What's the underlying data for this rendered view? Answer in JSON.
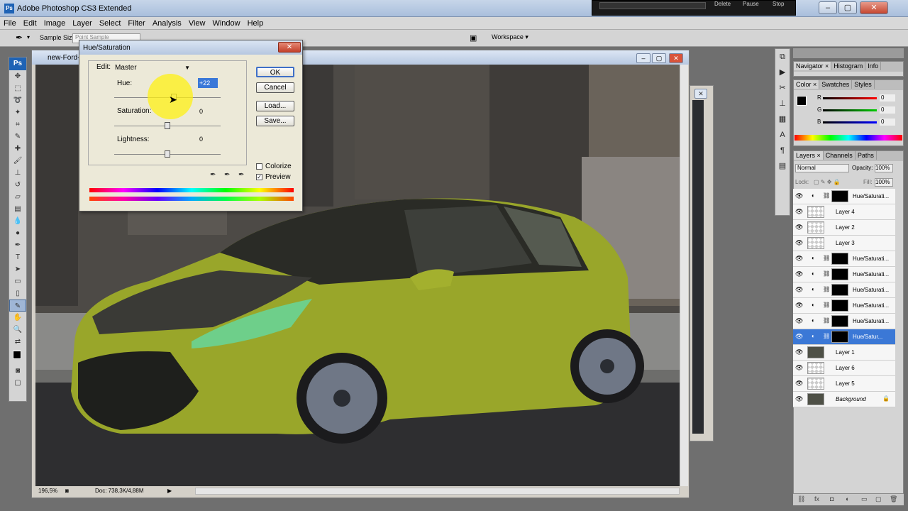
{
  "app": {
    "title": "Adobe Photoshop CS3 Extended",
    "logo": "Ps"
  },
  "recorder": {
    "delete": "Delete",
    "pause": "Pause",
    "stop": "Stop"
  },
  "window_controls": {
    "minimize": "–",
    "maximize": "▢",
    "close": "✕"
  },
  "menu": [
    "File",
    "Edit",
    "Image",
    "Layer",
    "Select",
    "Filter",
    "Analysis",
    "View",
    "Window",
    "Help"
  ],
  "options_bar": {
    "sample_size_label": "Sample Size:",
    "sample_size_value": "Point Sample",
    "workspace": "Workspace ▾"
  },
  "toolbox": {
    "logo": "Ps",
    "tools": [
      "move-icon",
      "marquee-icon",
      "lasso-icon",
      "magic-wand-icon",
      "crop-icon",
      "eyedropper-icon",
      "healing-icon",
      "brush-icon",
      "stamp-icon",
      "history-brush-icon",
      "eraser-icon",
      "gradient-icon",
      "blur-icon",
      "dodge-icon",
      "pen-icon",
      "type-icon",
      "path-select-icon",
      "shape-icon",
      "notes-icon",
      "eyedropper-active-icon",
      "hand-icon",
      "zoom-icon"
    ]
  },
  "document": {
    "title": "new-Ford-",
    "zoom": "196,5%",
    "doc_info": "Doc: 738,3K/4,88M"
  },
  "dialog": {
    "title": "Hue/Saturation",
    "edit_label": "Edit:",
    "edit_value": "Master",
    "hue_label": "Hue:",
    "hue_value": "+22",
    "saturation_label": "Saturation:",
    "saturation_value": "0",
    "lightness_label": "Lightness:",
    "lightness_value": "0",
    "ok": "OK",
    "cancel": "Cancel",
    "load": "Load...",
    "save": "Save...",
    "colorize": "Colorize",
    "preview": "Preview",
    "colorize_checked": false,
    "preview_checked": true,
    "hue_level": 22,
    "saturation_level": 0,
    "lightness_level": 0
  },
  "panels": {
    "navigator_tabs": [
      "Navigator ×",
      "Histogram",
      "Info"
    ],
    "color_tabs": [
      "Color ×",
      "Swatches",
      "Styles"
    ],
    "color": {
      "r_label": "R",
      "g_label": "G",
      "b_label": "B",
      "r": "0",
      "g": "0",
      "b": "0"
    },
    "layers_tabs": [
      "Layers ×",
      "Channels",
      "Paths"
    ],
    "blend_mode": "Normal",
    "opacity_label": "Opacity:",
    "opacity_value": "100%",
    "lock_label": "Lock:",
    "fill_label": "Fill:",
    "fill_value": "100%"
  },
  "layers": [
    {
      "name": "Hue/Saturati...",
      "type": "adjustment",
      "selected": false
    },
    {
      "name": "Layer 4",
      "type": "pixel",
      "selected": false
    },
    {
      "name": "Layer 2",
      "type": "pixel",
      "selected": false
    },
    {
      "name": "Layer 3",
      "type": "pixel",
      "selected": false
    },
    {
      "name": "Hue/Saturati...",
      "type": "adjustment",
      "selected": false
    },
    {
      "name": "Hue/Saturati...",
      "type": "adjustment",
      "selected": false
    },
    {
      "name": "Hue/Saturati...",
      "type": "adjustment",
      "selected": false
    },
    {
      "name": "Hue/Saturati...",
      "type": "adjustment",
      "selected": false
    },
    {
      "name": "Hue/Saturati...",
      "type": "adjustment",
      "selected": false
    },
    {
      "name": "Hue/Satur...",
      "type": "adjustment",
      "selected": true
    },
    {
      "name": "Layer 1",
      "type": "photo",
      "selected": false
    },
    {
      "name": "Layer 6",
      "type": "pixel",
      "selected": false
    },
    {
      "name": "Layer 5",
      "type": "pixel",
      "selected": false
    },
    {
      "name": "Background",
      "type": "photo",
      "selected": false
    }
  ],
  "colors": {
    "car_body": "#9aa82a",
    "accent_blue": "#3b78d6"
  }
}
